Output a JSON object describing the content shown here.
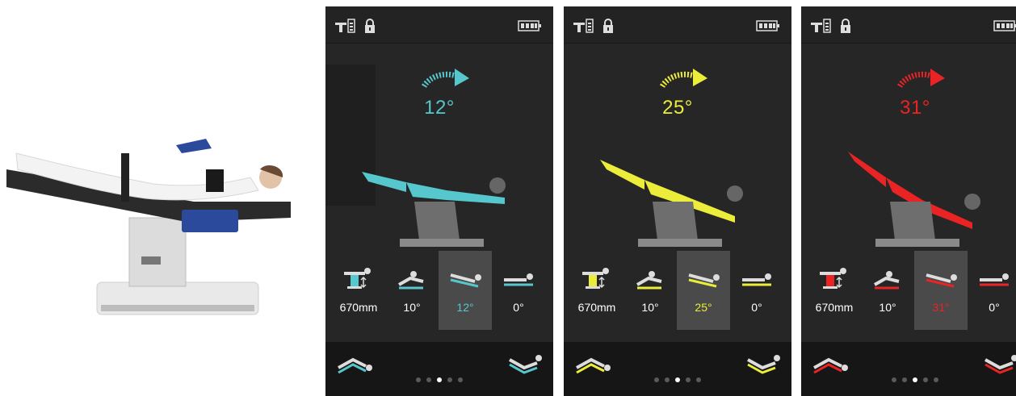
{
  "screens": [
    {
      "accent": "#55c7cd",
      "angle": "12°",
      "stats": [
        "670mm",
        "10°",
        "12°",
        "0°"
      ],
      "selected": 2,
      "pages": 5,
      "active_page": 2
    },
    {
      "accent": "#ecec3a",
      "angle": "25°",
      "stats": [
        "670mm",
        "10°",
        "25°",
        "0°"
      ],
      "selected": 2,
      "pages": 5,
      "active_page": 2
    },
    {
      "accent": "#ea2424",
      "angle": "31°",
      "stats": [
        "670mm",
        "10°",
        "31°",
        "0°"
      ],
      "selected": 2,
      "pages": 5,
      "active_page": 2
    }
  ],
  "icons": {
    "status_table": "table-status-icon",
    "status_lock": "lock-icon",
    "status_battery": "battery-icon",
    "tilt": "tilt-arrow-icon",
    "stat_icons": [
      "table-height-icon",
      "back-section-icon",
      "trend-tilt-icon",
      "lateral-tilt-icon"
    ],
    "nav_left": "reverse-trendelenburg-icon",
    "nav_right": "trendelenburg-icon"
  }
}
